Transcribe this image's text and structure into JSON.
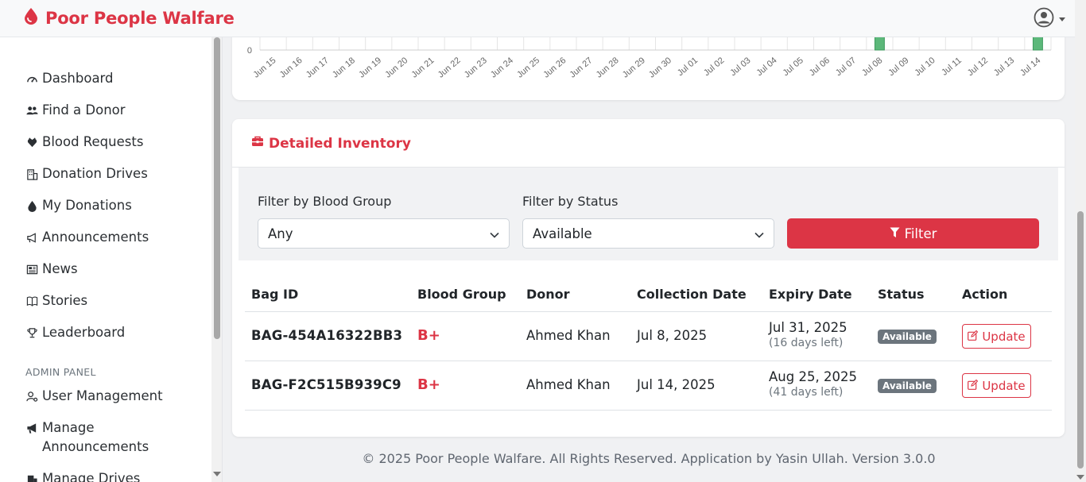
{
  "app": {
    "brand": "Poor People Walfare",
    "brand_color": "#dc3545"
  },
  "sidebar": {
    "items": [
      {
        "label": "Dashboard",
        "icon": "speedometer-icon"
      },
      {
        "label": "Find a Donor",
        "icon": "users-icon"
      },
      {
        "label": "Blood Requests",
        "icon": "hand-holding-heart-icon"
      },
      {
        "label": "Donation Drives",
        "icon": "building-icon"
      },
      {
        "label": "My Donations",
        "icon": "droplet-icon"
      },
      {
        "label": "Announcements",
        "icon": "megaphone-icon"
      },
      {
        "label": "News",
        "icon": "newspaper-icon"
      },
      {
        "label": "Stories",
        "icon": "book-icon"
      },
      {
        "label": "Leaderboard",
        "icon": "trophy-icon"
      }
    ],
    "admin_section": "ADMIN PANEL",
    "admin_items": [
      {
        "label": "User Management",
        "icon": "user-gear-icon"
      },
      {
        "label": "Manage Announcements",
        "icon": "megaphone-solid-icon"
      },
      {
        "label": "Manage Drives",
        "icon": "building-solid-icon"
      }
    ]
  },
  "chart_data": {
    "type": "bar",
    "categories": [
      "Jun 15",
      "Jun 16",
      "Jun 17",
      "Jun 18",
      "Jun 19",
      "Jun 20",
      "Jun 21",
      "Jun 22",
      "Jun 23",
      "Jun 24",
      "Jun 25",
      "Jun 26",
      "Jun 27",
      "Jun 28",
      "Jun 29",
      "Jun 30",
      "Jul 01",
      "Jul 02",
      "Jul 03",
      "Jul 04",
      "Jul 05",
      "Jul 06",
      "Jul 07",
      "Jul 08",
      "Jul 09",
      "Jul 10",
      "Jul 11",
      "Jul 12",
      "Jul 13",
      "Jul 14"
    ],
    "values": [
      0,
      0,
      0,
      0,
      0,
      0,
      0,
      0,
      0,
      0,
      0,
      0,
      0,
      0,
      0,
      0,
      0,
      0,
      0,
      0,
      0,
      0,
      0,
      1,
      0,
      0,
      0,
      0,
      0,
      1
    ],
    "y_tick_labels": [
      "0"
    ],
    "bar_color": "#5cb87a",
    "ylim": [
      0,
      1
    ]
  },
  "inventory": {
    "title": "Detailed Inventory",
    "filter_blood_group_label": "Filter by Blood Group",
    "filter_blood_group_value": "Any",
    "filter_status_label": "Filter by Status",
    "filter_status_value": "Available",
    "filter_button": "Filter",
    "columns": [
      "Bag ID",
      "Blood Group",
      "Donor",
      "Collection Date",
      "Expiry Date",
      "Status",
      "Action"
    ],
    "rows": [
      {
        "bag_id": "BAG-454A16322BB3",
        "blood_group": "B+",
        "donor": "Ahmed Khan",
        "collection_date": "Jul 8, 2025",
        "expiry_date": "Jul 31, 2025",
        "days_left": "(16 days left)",
        "status": "Available",
        "action": "Update"
      },
      {
        "bag_id": "BAG-F2C515B939C9",
        "blood_group": "B+",
        "donor": "Ahmed Khan",
        "collection_date": "Jul 14, 2025",
        "expiry_date": "Aug 25, 2025",
        "days_left": "(41 days left)",
        "status": "Available",
        "action": "Update"
      }
    ]
  },
  "footer": "© 2025 Poor People Walfare. All Rights Reserved. Application by Yasin Ullah. Version 3.0.0"
}
